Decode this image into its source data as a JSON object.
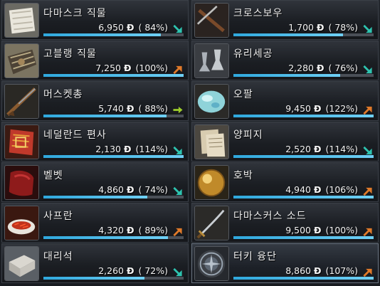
{
  "currency_symbol": "Đ",
  "colors": {
    "trend_down": "#2ec4b0",
    "trend_up": "#e07a2a",
    "trend_flat": "#9ccc2c",
    "bar": "#2fa8dd"
  },
  "left_items": [
    {
      "name": "다마스크 직물",
      "price": "6,950",
      "percent": "( 84%)",
      "ratio": 0.84,
      "trend": "down",
      "icon": "damask-cloth-icon"
    },
    {
      "name": "고블랭 직물",
      "price": "7,250",
      "percent": "(100%)",
      "ratio": 1.0,
      "trend": "up",
      "icon": "gobelin-tapestry-icon"
    },
    {
      "name": "머스켓총",
      "price": "5,740",
      "percent": "( 88%)",
      "ratio": 0.88,
      "trend": "flat",
      "icon": "musket-icon"
    },
    {
      "name": "네덜란드 편사",
      "price": "2,130",
      "percent": "(114%)",
      "ratio": 1.0,
      "trend": "down",
      "icon": "dutch-yarn-icon"
    },
    {
      "name": "벨벳",
      "price": "4,860",
      "percent": "( 74%)",
      "ratio": 0.74,
      "trend": "down",
      "icon": "velvet-icon"
    },
    {
      "name": "사프란",
      "price": "4,320",
      "percent": "( 89%)",
      "ratio": 0.89,
      "trend": "up",
      "icon": "saffron-icon"
    },
    {
      "name": "대리석",
      "price": "2,260",
      "percent": "( 72%)",
      "ratio": 0.72,
      "trend": "down",
      "icon": "marble-icon"
    }
  ],
  "right_items": [
    {
      "name": "크로스보우",
      "price": "1,700",
      "percent": "( 78%)",
      "ratio": 0.78,
      "trend": "down",
      "icon": "crossbow-icon"
    },
    {
      "name": "유리세공",
      "price": "2,280",
      "percent": "( 76%)",
      "ratio": 0.76,
      "trend": "down",
      "icon": "glasswork-icon"
    },
    {
      "name": "오팔",
      "price": "9,450",
      "percent": "(122%)",
      "ratio": 1.0,
      "trend": "up",
      "icon": "opal-icon"
    },
    {
      "name": "양피지",
      "price": "2,520",
      "percent": "(114%)",
      "ratio": 1.0,
      "trend": "down",
      "icon": "parchment-icon"
    },
    {
      "name": "호박",
      "price": "4,940",
      "percent": "(106%)",
      "ratio": 1.0,
      "trend": "up",
      "icon": "amber-icon"
    },
    {
      "name": "다마스커스 소드",
      "price": "9,500",
      "percent": "(100%)",
      "ratio": 1.0,
      "trend": "up",
      "icon": "damascus-sword-icon"
    },
    {
      "name": "터키 융단",
      "price": "8,860",
      "percent": "(107%)",
      "ratio": 1.0,
      "trend": "up",
      "icon": "turkish-carpet-icon",
      "selected": true
    }
  ]
}
